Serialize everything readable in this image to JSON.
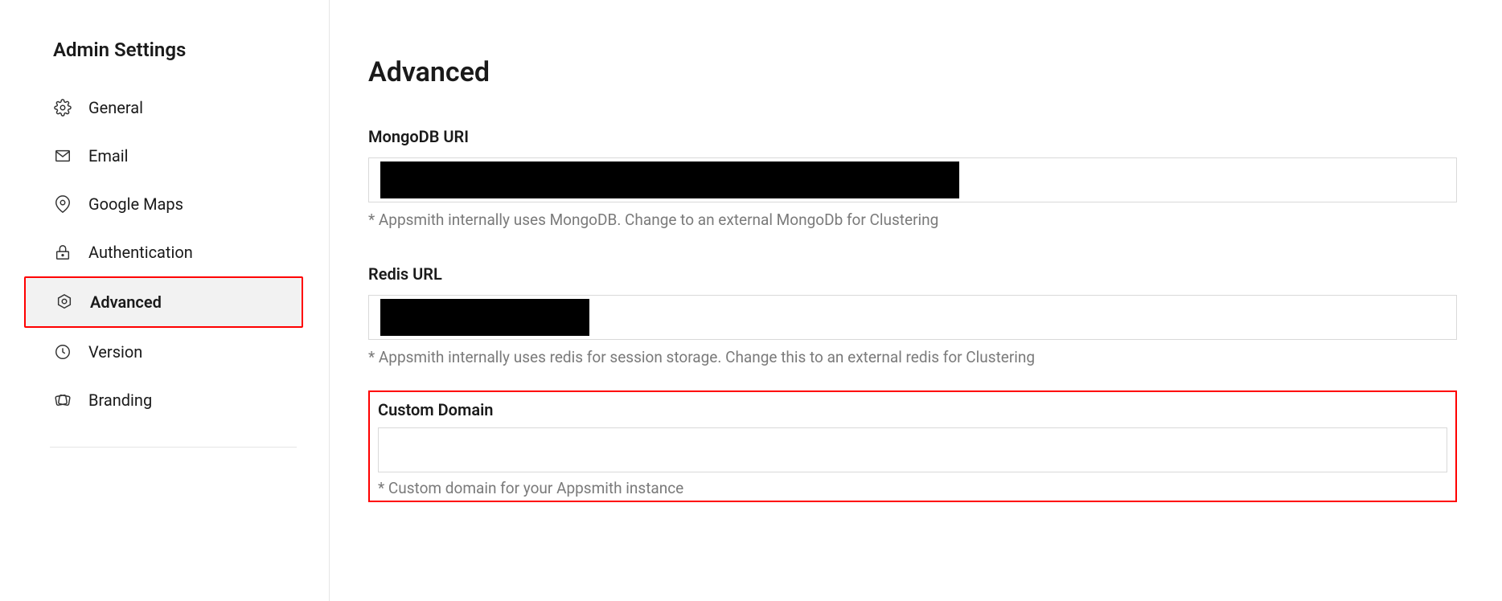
{
  "sidebar": {
    "title": "Admin Settings",
    "items": [
      {
        "label": "General"
      },
      {
        "label": "Email"
      },
      {
        "label": "Google Maps"
      },
      {
        "label": "Authentication"
      },
      {
        "label": "Advanced"
      },
      {
        "label": "Version"
      },
      {
        "label": "Branding"
      }
    ]
  },
  "main": {
    "title": "Advanced",
    "fields": {
      "mongo": {
        "label": "MongoDB URI",
        "help": "* Appsmith internally uses MongoDB. Change to an external MongoDb for Clustering"
      },
      "redis": {
        "label": "Redis URL",
        "help": "* Appsmith internally uses redis for session storage. Change this to an external redis for Clustering"
      },
      "custom_domain": {
        "label": "Custom Domain",
        "value": "",
        "help": "* Custom domain for your Appsmith instance"
      }
    }
  }
}
